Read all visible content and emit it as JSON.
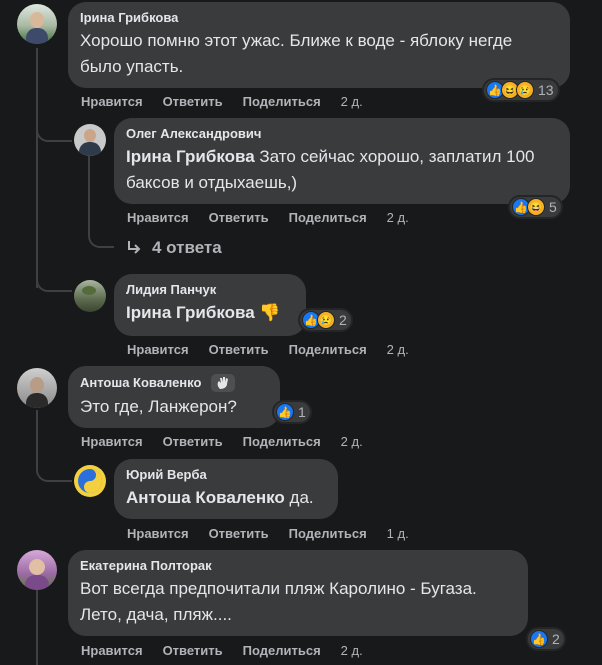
{
  "comments": [
    {
      "author": "Ірина Грибкова",
      "text": "Хорошо помню этот ужас. Ближе к воде - яблоку негде было упасть.",
      "like": "Нравится",
      "reply": "Ответить",
      "share": "Поделиться",
      "time": "2 д.",
      "reactions": "13"
    },
    {
      "author": "Олег Александрович",
      "mention": "Ірина Грибкова",
      "text": " Зато сейчас хорошо, заплатил 100 баксов и отдыхаешь,)",
      "like": "Нравится",
      "reply": "Ответить",
      "share": "Поделиться",
      "time": "2 д.",
      "reactions": "5"
    },
    {
      "author": "Лидия Панчук",
      "mention": "Ірина Грибкова",
      "text": " 👎",
      "like": "Нравится",
      "reply": "Ответить",
      "share": "Поделиться",
      "time": "2 д.",
      "reactions": "2"
    },
    {
      "author": "Антоша Коваленко",
      "text": "Это где, Ланжерон?",
      "like": "Нравится",
      "reply": "Ответить",
      "share": "Поделиться",
      "time": "2 д.",
      "reactions": "1"
    },
    {
      "author": "Юрий Верба",
      "mention": "Антоша Коваленко",
      "text": " да.",
      "like": "Нравится",
      "reply": "Ответить",
      "share": "Поделиться",
      "time": "1 д."
    },
    {
      "author": "Екатерина Полторак",
      "text": "Вот всегда предпочитали пляж Каролино - Бугаза. Лето, дача, пляж....",
      "like": "Нравится",
      "reply": "Ответить",
      "share": "Поделиться",
      "time": "2 д.",
      "reactions": "2"
    }
  ],
  "more_replies": "4 ответа",
  "icons": {
    "reply_arrow": "reply-arrow-icon",
    "badge": "waving-hand-badge-icon",
    "like": "👍",
    "haha": "😆",
    "sad": "😢"
  }
}
